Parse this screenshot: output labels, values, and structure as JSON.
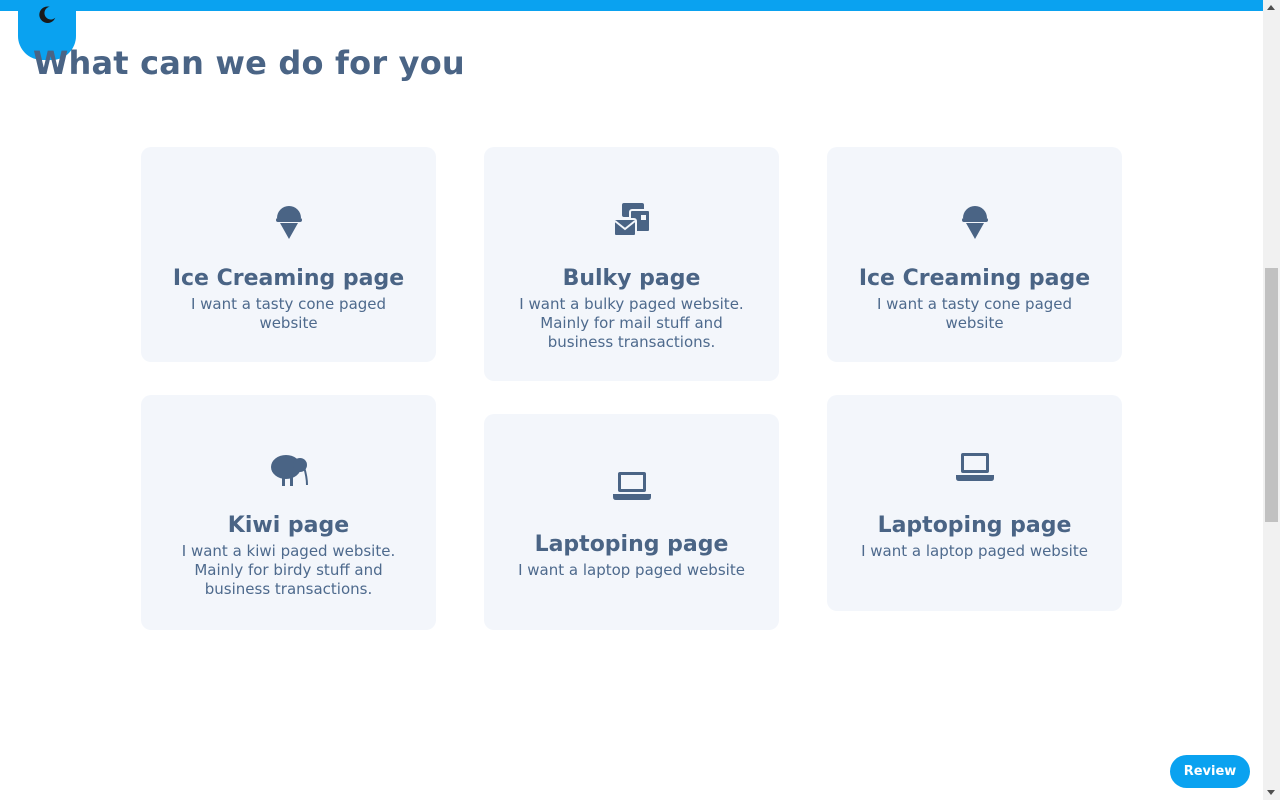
{
  "heading": "What can we do for you",
  "review_label": "Review",
  "colors": {
    "accent": "#0aa2f0",
    "text": "#4a6485",
    "card_bg": "#f3f6fb"
  },
  "theme_toggle": {
    "icon": "moon-icon"
  },
  "cards": [
    {
      "icon": "ice-cream-icon",
      "title": "Ice Creaming page",
      "desc": "I want a tasty cone paged website"
    },
    {
      "icon": "mail-bulk-icon",
      "title": "Bulky page",
      "desc": "I want a bulky paged website. Mainly for mail stuff and business transactions."
    },
    {
      "icon": "ice-cream-icon",
      "title": "Ice Creaming page",
      "desc": "I want a tasty cone paged website"
    },
    {
      "icon": "kiwi-bird-icon",
      "title": "Kiwi page",
      "desc": "I want a kiwi paged website. Mainly for birdy stuff and business transactions."
    },
    {
      "icon": "laptop-icon",
      "title": "Laptoping page",
      "desc": "I want a laptop paged website"
    },
    {
      "icon": "laptop-icon",
      "title": "Laptoping page",
      "desc": "I want a laptop paged website"
    }
  ]
}
